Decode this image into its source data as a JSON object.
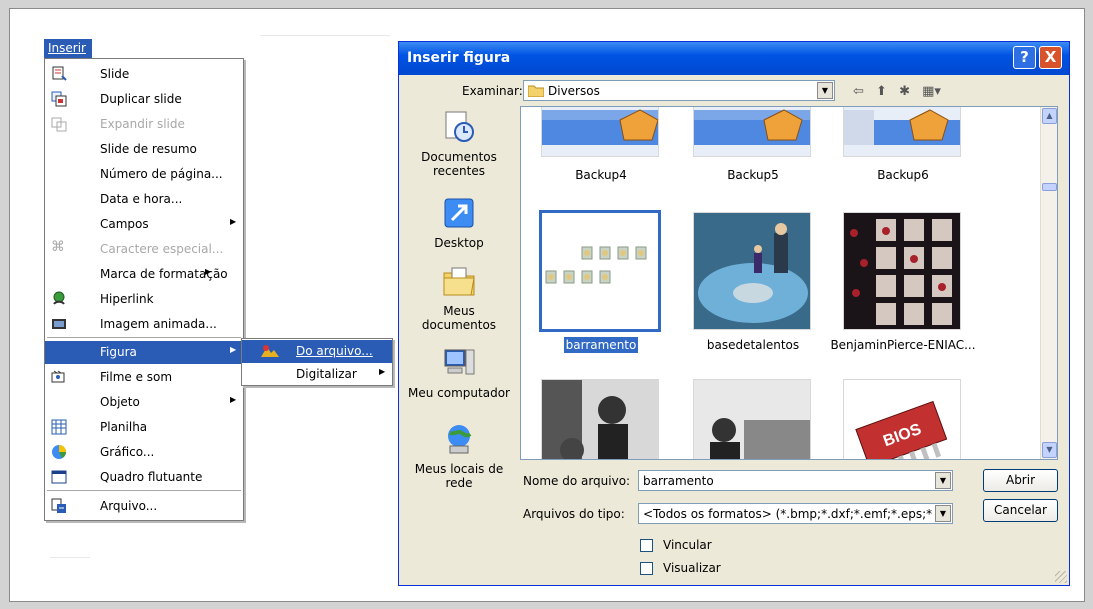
{
  "menu": {
    "title": "Inserir",
    "items": [
      {
        "label": "Slide",
        "icon": "slide-icon",
        "disabled": false
      },
      {
        "label": "Duplicar slide",
        "icon": "duplicate-slide-icon",
        "disabled": false
      },
      {
        "label": "Expandir slide",
        "icon": "expand-slide-icon",
        "disabled": true
      },
      {
        "label": "Slide de resumo",
        "icon": "",
        "disabled": false
      },
      {
        "label": "Número de página...",
        "icon": "",
        "disabled": false
      },
      {
        "label": "Data e hora...",
        "icon": "",
        "disabled": false
      },
      {
        "label": "Campos",
        "icon": "",
        "disabled": false,
        "submenu": true
      },
      {
        "label": "Caractere especial...",
        "icon": "special-char-icon",
        "disabled": true
      },
      {
        "label": "Marca de formatação",
        "icon": "",
        "disabled": false,
        "submenu": true
      },
      {
        "label": "Hiperlink",
        "icon": "hyperlink-icon",
        "disabled": false
      },
      {
        "label": "Imagem animada...",
        "icon": "animated-image-icon",
        "disabled": false
      },
      {
        "label": "Figura",
        "icon": "",
        "disabled": false,
        "submenu": true,
        "active": true
      },
      {
        "label": "Filme e som",
        "icon": "movie-sound-icon",
        "disabled": false
      },
      {
        "label": "Objeto",
        "icon": "",
        "disabled": false,
        "submenu": true
      },
      {
        "label": "Planilha",
        "icon": "spreadsheet-icon",
        "disabled": false
      },
      {
        "label": "Gráfico...",
        "icon": "chart-icon",
        "disabled": false
      },
      {
        "label": "Quadro flutuante",
        "icon": "floating-frame-icon",
        "disabled": false
      },
      {
        "label": "Arquivo...",
        "icon": "file-icon",
        "disabled": false
      }
    ],
    "submenu": [
      {
        "label": "Do arquivo...",
        "active": true
      },
      {
        "label": "Digitalizar",
        "arrow": true
      }
    ]
  },
  "dialog": {
    "title": "Inserir figura",
    "help_btn": "?",
    "close_btn": "X",
    "lookin_label": "Examinar:",
    "lookin_value": "Diversos",
    "places": [
      "Documentos recentes",
      "Desktop",
      "Meus documentos",
      "Meu computador",
      "Meus locais de rede"
    ],
    "files": [
      "Backup4",
      "Backup5",
      "Backup6",
      "barramento",
      "basedetalentos",
      "BenjaminPierce-ENIAC..."
    ],
    "filename_label": "Nome do arquivo:",
    "filename_value": "barramento",
    "filetype_label": "Arquivos do tipo:",
    "filetype_value": "<Todos os formatos> (*.bmp;*.dxf;*.emf;*.eps;*.gif;*.",
    "open_btn": "Abrir",
    "cancel_btn": "Cancelar",
    "link_label": "Vincular",
    "preview_label": "Visualizar",
    "thumb_text": "BIOS"
  },
  "colors": {
    "accent": "#2a5cb5",
    "title_bar": "#0054e3",
    "dialog_bg": "#ece9d8"
  }
}
